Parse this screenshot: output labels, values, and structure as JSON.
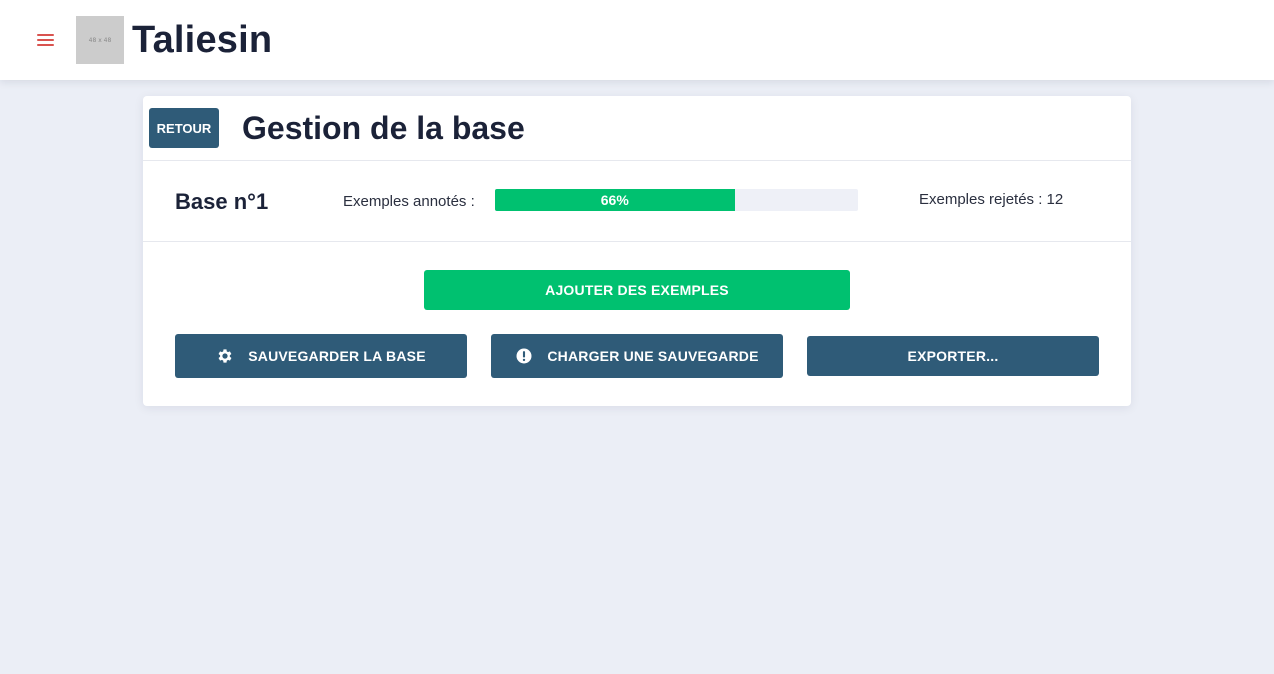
{
  "header": {
    "menu_icon": "hamburger-menu-icon",
    "logo_text": "48 x 48",
    "app_title": "Taliesin",
    "accent_color": "#d9534f"
  },
  "card": {
    "back_label": "RETOUR",
    "title": "Gestion de la base"
  },
  "stats": {
    "base_name": "Base n°1",
    "annotated_label": "Exemples annotés :",
    "annotated_progress": 0.66,
    "annotated_percent_text": "66%",
    "rejected_text": "Exemples rejetés : 12"
  },
  "actions": {
    "add_label": "AJOUTER DES EXEMPLES",
    "save_label": "SAUVEGARDER LA BASE",
    "save_icon": "gear-icon",
    "load_label": "CHARGER UNE SAUVEGARDE",
    "load_icon": "exclamation-circle-icon",
    "export_label": "EXPORTER..."
  },
  "colors": {
    "primary": "#2f5b78",
    "success": "#00c170",
    "background": "#ebeef6",
    "text": "#1b2238"
  }
}
